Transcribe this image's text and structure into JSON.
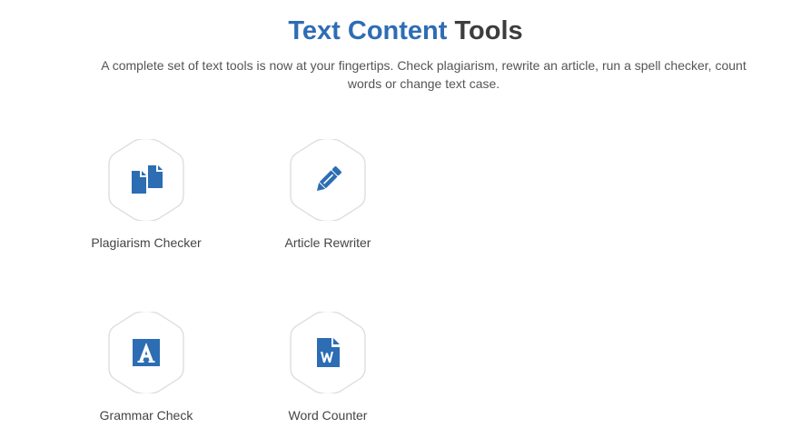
{
  "header": {
    "title_accent": "Text Content",
    "title_rest": "Tools",
    "subtitle": "A complete set of text tools is now at your fingertips. Check plagiarism, rewrite an article, run a spell checker, count words or change text case."
  },
  "colors": {
    "accent": "#2e6db4",
    "icon": "#2c6db3",
    "hex_border": "#dcdcdc"
  },
  "tools": [
    {
      "label": "Plagiarism Checker",
      "icon": "copy-documents-icon"
    },
    {
      "label": "Article Rewriter",
      "icon": "pencil-icon"
    },
    {
      "label": "Grammar Check",
      "icon": "letter-a-icon"
    },
    {
      "label": "Word Counter",
      "icon": "word-document-icon"
    }
  ]
}
